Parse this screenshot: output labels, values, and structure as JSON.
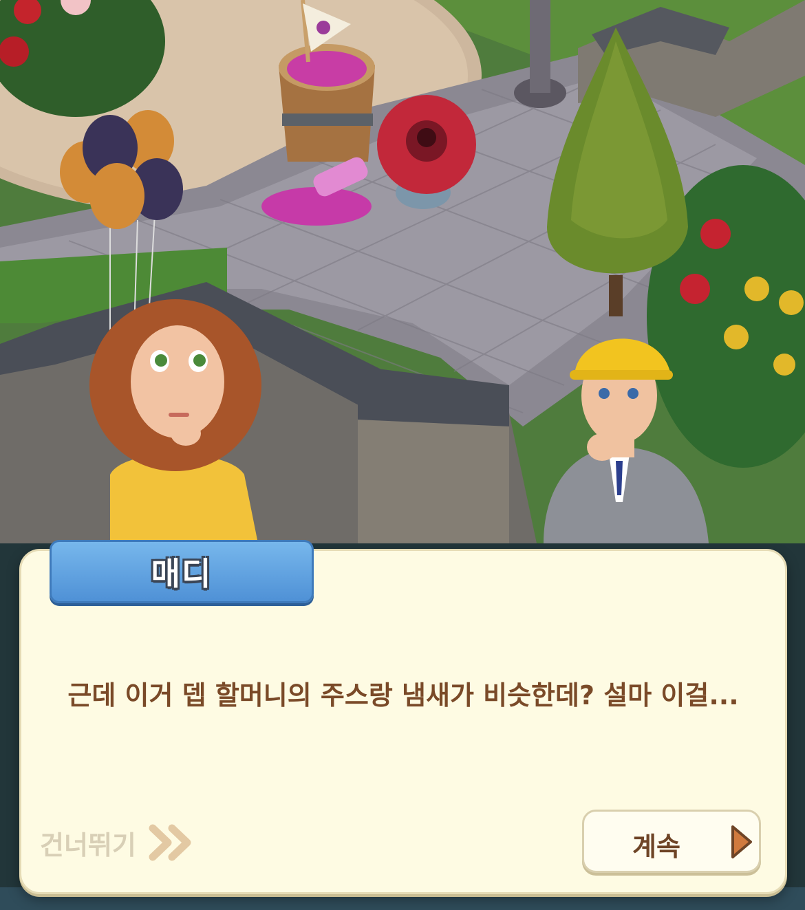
{
  "dialog": {
    "speaker": "매디",
    "text": "근데 이거 뎁 할머니의 주스랑 냄새가 비슷한데? 설마 이걸...",
    "skip_label": "건너뛰기",
    "continue_label": "계속"
  },
  "icons": {
    "skip": "double-chevron-right-icon",
    "continue": "triangle-right-icon"
  },
  "scene": {
    "characters": [
      "madison",
      "construction-worker"
    ],
    "props": [
      "balloons",
      "grape-juice-barrel",
      "spilled-juice-bottle",
      "rafflesia-flower",
      "cypress-tree",
      "flower-bed",
      "stone-wall",
      "lamp-post"
    ]
  },
  "colors": {
    "panel": "#fefbe3",
    "name_tag": "#5b9ddd",
    "dialog_text": "#7a4a28",
    "skip_text": "#d8cfb6",
    "continue_arrow": "#d07a3e"
  }
}
